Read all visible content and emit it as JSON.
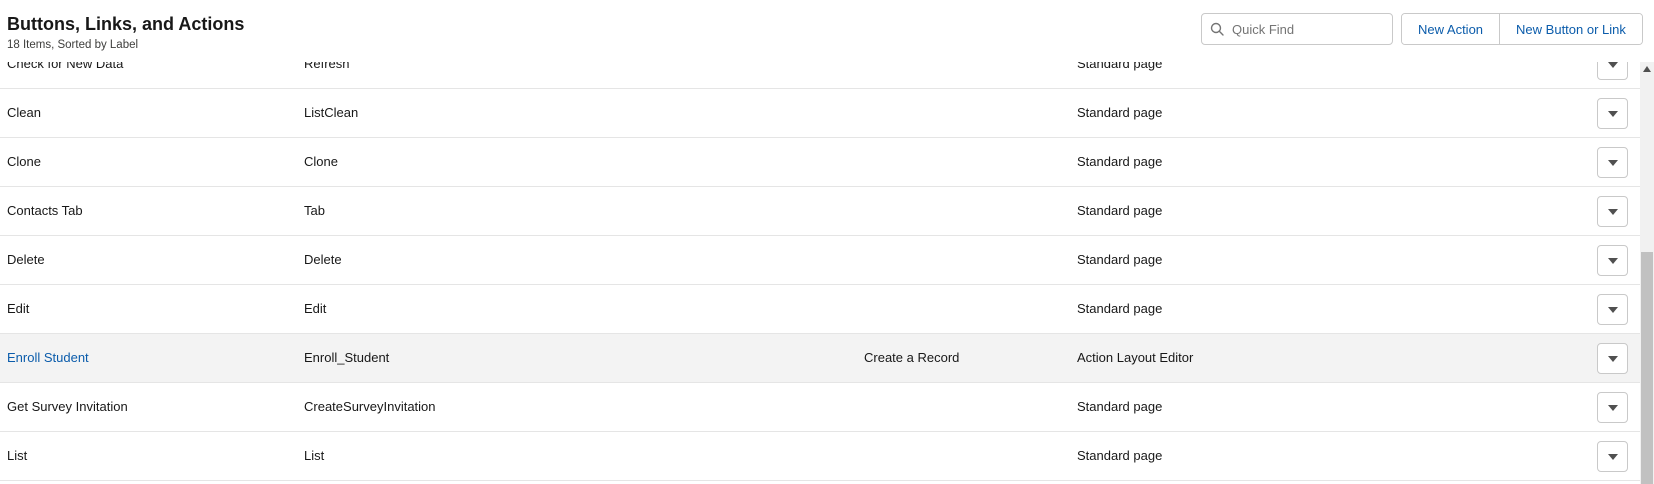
{
  "header": {
    "title": "Buttons, Links, and Actions",
    "subtitle": "18 Items, Sorted by Label"
  },
  "search": {
    "placeholder": "Quick Find",
    "icon": "search-icon"
  },
  "actions": {
    "new_action": "New Action",
    "new_button_or_link": "New Button or Link"
  },
  "rows": [
    {
      "label": "Check for New Data",
      "name": "Refresh",
      "type": "",
      "override": "Standard page",
      "is_link": false
    },
    {
      "label": "Clean",
      "name": "ListClean",
      "type": "",
      "override": "Standard page",
      "is_link": false
    },
    {
      "label": "Clone",
      "name": "Clone",
      "type": "",
      "override": "Standard page",
      "is_link": false
    },
    {
      "label": "Contacts Tab",
      "name": "Tab",
      "type": "",
      "override": "Standard page",
      "is_link": false
    },
    {
      "label": "Delete",
      "name": "Delete",
      "type": "",
      "override": "Standard page",
      "is_link": false
    },
    {
      "label": "Edit",
      "name": "Edit",
      "type": "",
      "override": "Standard page",
      "is_link": false
    },
    {
      "label": "Enroll Student",
      "name": "Enroll_Student",
      "type": "Create a Record",
      "override": "Action Layout Editor",
      "is_link": true,
      "highlighted": true
    },
    {
      "label": "Get Survey Invitation",
      "name": "CreateSurveyInvitation",
      "type": "",
      "override": "Standard page",
      "is_link": false
    },
    {
      "label": "List",
      "name": "List",
      "type": "",
      "override": "Standard page",
      "is_link": false
    }
  ],
  "colors": {
    "link": "#0b5cab",
    "border": "#c9c9c9",
    "highlight_row": "#f3f3f3"
  }
}
